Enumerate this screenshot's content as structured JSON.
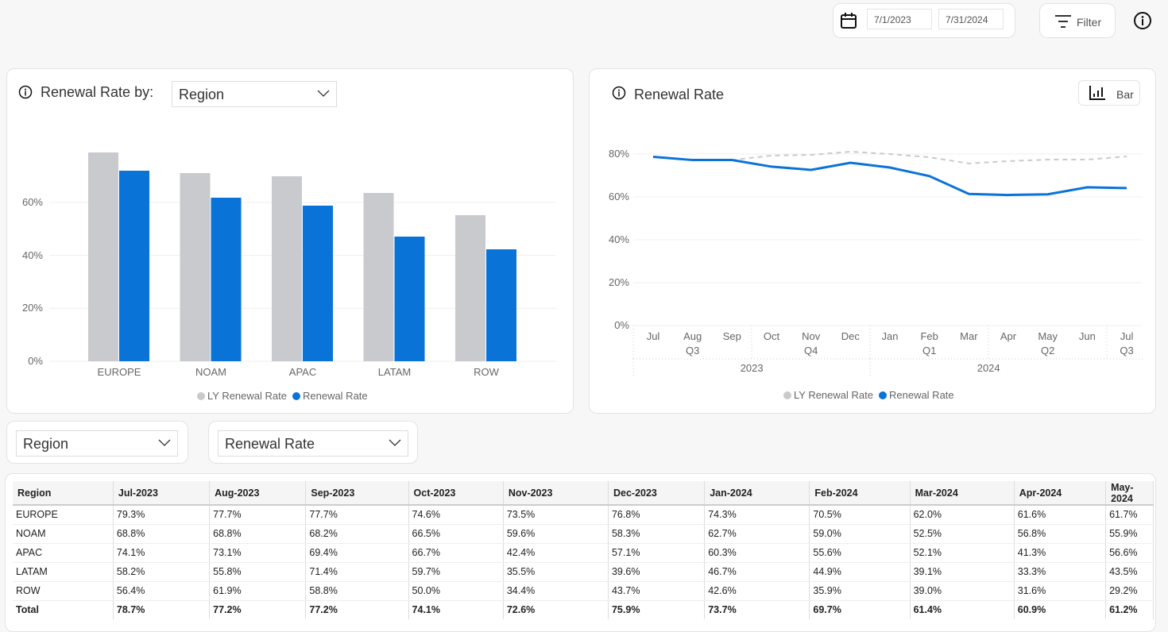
{
  "toolbar": {
    "start_date": "7/1/2023",
    "end_date": "7/31/2024",
    "filter_label": "Filter",
    "icons": [
      "calendar-icon",
      "filter-icon",
      "info-icon"
    ]
  },
  "bar_card": {
    "title": "Renewal Rate by:",
    "dropdown_value": "Region"
  },
  "line_card": {
    "title": "Renewal Rate",
    "toggle_label": "Bar"
  },
  "selectors": {
    "dimension": "Region",
    "measure": "Renewal Rate"
  },
  "colors": {
    "ly": "#c8cacd",
    "current": "#0a73d8"
  },
  "chart_data": [
    {
      "type": "bar",
      "categories": [
        "EUROPE",
        "NOAM",
        "APAC",
        "LATAM",
        "ROW"
      ],
      "series": [
        {
          "name": "LY Renewal Rate",
          "values": [
            78.9,
            71.1,
            69.9,
            63.6,
            55.2
          ]
        },
        {
          "name": "Renewal Rate",
          "values": [
            72.0,
            61.8,
            58.8,
            47.1,
            42.3
          ]
        }
      ],
      "yticks": [
        "0%",
        "20%",
        "40%",
        "60%"
      ],
      "ylim": [
        0,
        80
      ],
      "grid": true,
      "legend": "bottom"
    },
    {
      "type": "line",
      "x": [
        "Jul",
        "Aug",
        "Sep",
        "Oct",
        "Nov",
        "Dec",
        "Jan",
        "Feb",
        "Mar",
        "Apr",
        "May",
        "Jun",
        "Jul"
      ],
      "quarters": [
        {
          "label": "Q3",
          "at": 1
        },
        {
          "label": "Q4",
          "at": 4
        },
        {
          "label": "Q1",
          "at": 7
        },
        {
          "label": "Q2",
          "at": 10
        },
        {
          "label": "Q3",
          "at": 12
        }
      ],
      "years": [
        {
          "label": "2023",
          "at": 3
        },
        {
          "label": "2024",
          "at": 9
        }
      ],
      "series": [
        {
          "name": "LY Renewal Rate",
          "values": [
            78.7,
            77.2,
            77.2,
            79.3,
            79.6,
            81.1,
            80.0,
            78.5,
            75.6,
            76.7,
            77.4,
            77.4,
            78.9
          ]
        },
        {
          "name": "Renewal Rate",
          "values": [
            78.7,
            77.2,
            77.2,
            74.1,
            72.6,
            75.9,
            73.7,
            69.7,
            61.4,
            60.9,
            61.2,
            64.5,
            64.1
          ]
        }
      ],
      "yticks": [
        "0%",
        "20%",
        "40%",
        "60%",
        "80%"
      ],
      "ylim": [
        0,
        90
      ],
      "grid": true,
      "legend": "bottom"
    }
  ],
  "table": {
    "headers": [
      "Region",
      "Jul-2023",
      "Aug-2023",
      "Sep-2023",
      "Oct-2023",
      "Nov-2023",
      "Dec-2023",
      "Jan-2024",
      "Feb-2024",
      "Mar-2024",
      "Apr-2024",
      "May-2024"
    ],
    "rows": [
      [
        "EUROPE",
        "79.3%",
        "77.7%",
        "77.7%",
        "74.6%",
        "73.5%",
        "76.8%",
        "74.3%",
        "70.5%",
        "62.0%",
        "61.6%",
        "61.7%"
      ],
      [
        "NOAM",
        "68.8%",
        "68.8%",
        "68.2%",
        "66.5%",
        "59.6%",
        "58.3%",
        "62.7%",
        "59.0%",
        "52.5%",
        "56.8%",
        "55.9%"
      ],
      [
        "APAC",
        "74.1%",
        "73.1%",
        "69.4%",
        "66.7%",
        "42.4%",
        "57.1%",
        "60.3%",
        "55.6%",
        "52.1%",
        "41.3%",
        "56.6%"
      ],
      [
        "LATAM",
        "58.2%",
        "55.8%",
        "71.4%",
        "59.7%",
        "35.5%",
        "39.6%",
        "46.7%",
        "44.9%",
        "39.1%",
        "33.3%",
        "43.5%"
      ],
      [
        "ROW",
        "56.4%",
        "61.9%",
        "58.8%",
        "50.0%",
        "34.4%",
        "43.7%",
        "42.6%",
        "35.9%",
        "39.0%",
        "31.6%",
        "29.2%"
      ],
      [
        "Total",
        "78.7%",
        "77.2%",
        "77.2%",
        "74.1%",
        "72.6%",
        "75.9%",
        "73.7%",
        "69.7%",
        "61.4%",
        "60.9%",
        "61.2%"
      ]
    ]
  }
}
